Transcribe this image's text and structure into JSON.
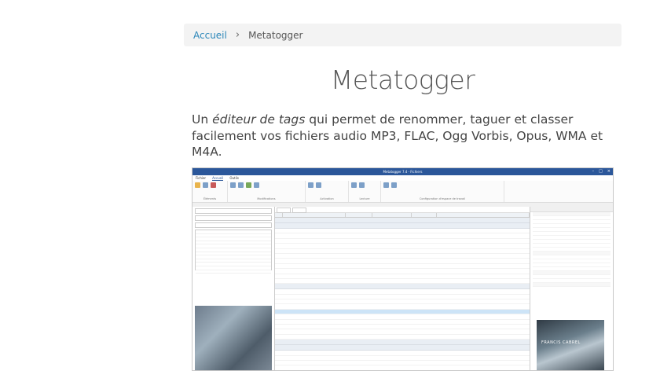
{
  "breadcrumb": {
    "home": "Accueil",
    "separator": "›",
    "current": "Metatogger"
  },
  "title": "Metatogger",
  "lead": {
    "before": "Un ",
    "emphasis": "éditeur de tags",
    "after": " qui permet de renommer, taguer et classer facilement vos fichiers audio MP3, FLAC, Ogg Vorbis, Opus, WMA et M4A."
  },
  "screenshot": {
    "window_title": "Metatogger 7.4 - Fichiers",
    "ribbon_tabs": [
      "Fichier",
      "Accueil",
      "Outils"
    ],
    "ribbon_groups": [
      "Éléments",
      "Modifications",
      "Activation",
      "Lecture",
      "Configuration d'espace de travail"
    ],
    "cover_text": "FRANCIS CABREL"
  }
}
